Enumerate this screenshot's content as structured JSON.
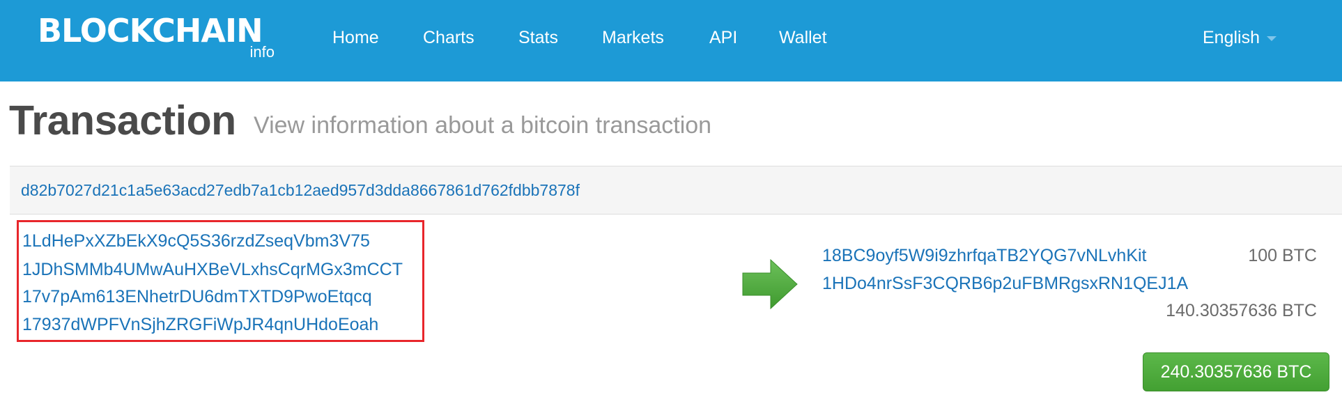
{
  "brand": {
    "name": "BLOCKCHAIN",
    "sub": "info"
  },
  "nav": {
    "items": [
      "Home",
      "Charts",
      "Stats",
      "Markets",
      "API",
      "Wallet"
    ],
    "language": "English"
  },
  "page": {
    "title": "Transaction",
    "subtitle": "View information about a bitcoin transaction"
  },
  "transaction": {
    "hash": "d82b7027d21c1a5e63acd27edb7a1cb12aed957d3dda8667861d762fdbb7878f",
    "inputs": [
      "1LdHePxXZbEkX9cQ5S36rzdZseqVbm3V75",
      "1JDhSMMb4UMwAuHXBeVLxhsCqrMGx3mCCT",
      "17v7pAm613ENhetrDU6dmTXTD9PwoEtqcq",
      "17937dWPFVnSjhZRGFiWpJR4qnUHdoEoah"
    ],
    "outputs": [
      {
        "address": "18BC9oyf5W9i9zhrfqaTB2YQG7vNLvhKit",
        "amount": "100 BTC"
      },
      {
        "address": "1HDo4nrSsF3CQRB6p2uFBMRgsxRN1QEJ1A",
        "amount": "140.30357636 BTC"
      }
    ],
    "total": "240.30357636 BTC"
  },
  "colors": {
    "navbar": "#1d9ad6",
    "link": "#1a73b8",
    "highlight_border": "#e8262b",
    "arrow": "#4caf3b",
    "total_button": "#4caf3b"
  },
  "icons": {
    "arrow": "arrow-right-icon",
    "language_caret": "caret-down-icon"
  }
}
